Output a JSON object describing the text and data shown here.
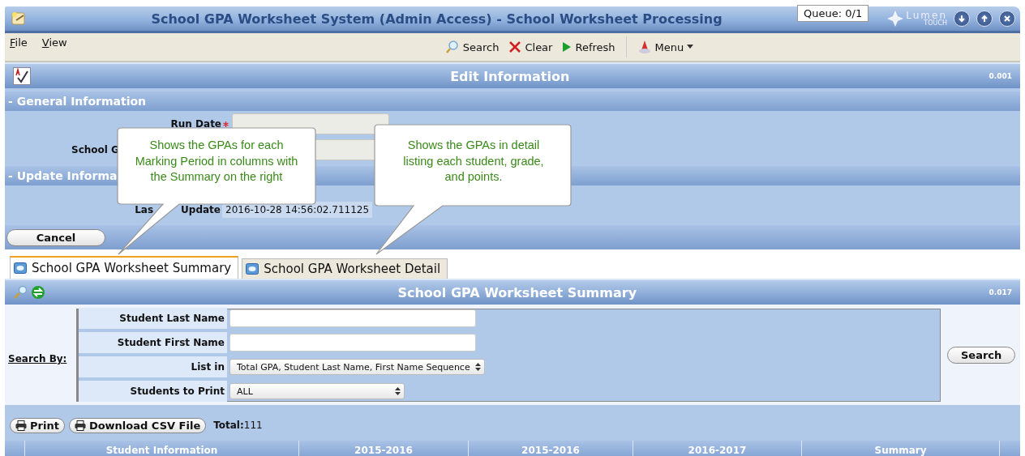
{
  "window": {
    "title": "School GPA Worksheet System (Admin Access) - School Worksheet Processing",
    "queue": "Queue: 0/1",
    "brand": "Lumen",
    "brand_sub": "TOUCH"
  },
  "menu": [
    "File",
    "View"
  ],
  "toolbar": [
    {
      "label": "Search",
      "kind": "search"
    },
    {
      "label": "Clear",
      "kind": "clear"
    },
    {
      "label": "Refresh",
      "kind": "refresh"
    },
    {
      "label": "Menu",
      "kind": "menu"
    }
  ],
  "edit_panel": {
    "title": "Edit Information",
    "timing": "0.001"
  },
  "general_section": {
    "title": "- General Information",
    "fields": [
      {
        "label": "Run Date",
        "required": true
      },
      {
        "label": "School G",
        "required": false
      }
    ]
  },
  "update_section": {
    "title": "- Update Informa",
    "label_start": "Las",
    "label_end": "Update",
    "value": "2016-10-28 14:56:02.711125"
  },
  "cancel": "Cancel",
  "tabs": [
    {
      "label": "School GPA Worksheet Summary",
      "selected": true
    },
    {
      "label": "School GPA Worksheet Detail",
      "selected": false
    }
  ],
  "callouts": [
    {
      "text": "Shows the GPAs for each Marking Period in columns with the Summary on the right"
    },
    {
      "text": "Shows the GPAs in detail listing each student, grade, and points."
    }
  ],
  "summary_panel": {
    "title": "School GPA Worksheet Summary",
    "timing": "0.017"
  },
  "search": {
    "label": "Search By:",
    "button": "Search",
    "fields": [
      {
        "label": "Student Last Name",
        "kind": "text"
      },
      {
        "label": "Student First Name",
        "kind": "text"
      },
      {
        "label": "List in",
        "kind": "select",
        "value": "Total GPA, Student Last Name, First Name Sequence"
      },
      {
        "label": "Students to Print",
        "kind": "select",
        "value": "ALL"
      }
    ]
  },
  "actions": [
    "Print",
    "Download CSV File"
  ],
  "total": {
    "label": "Total:",
    "value": "111"
  },
  "table": {
    "columns": [
      "Student Information",
      "2015-2016",
      "2015-2016",
      "2016-2017",
      "Summary"
    ]
  }
}
